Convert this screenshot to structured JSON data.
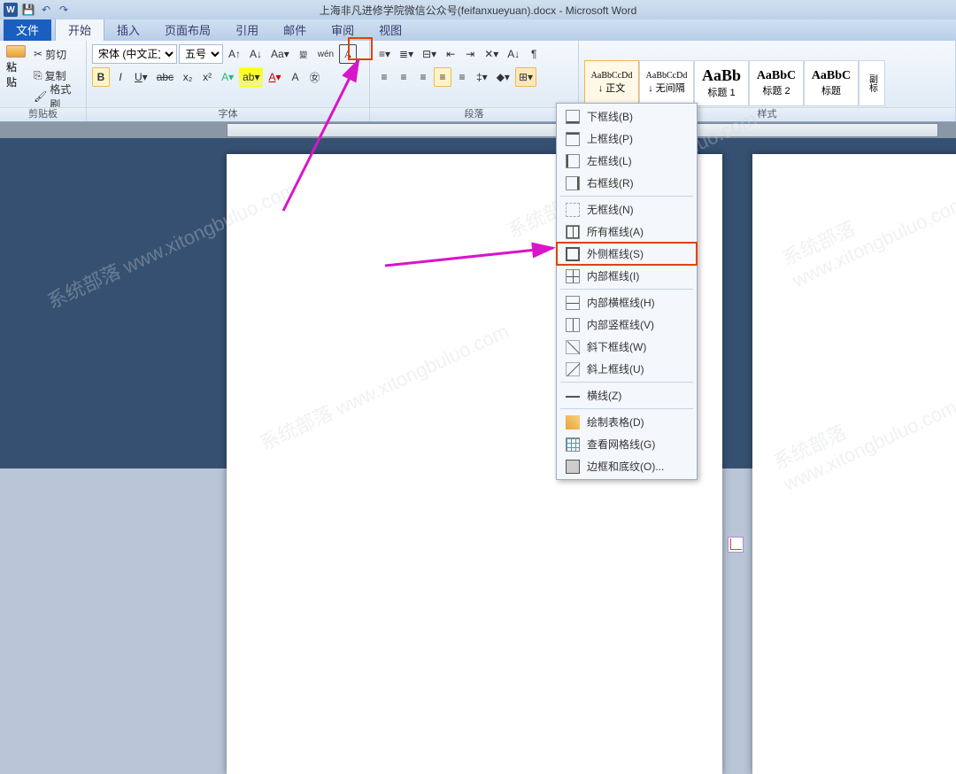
{
  "title": "上海非凡进修学院微信公众号(feifanxueyuan).docx - Microsoft Word",
  "qat": {
    "app": "W"
  },
  "tabs": {
    "file": "文件",
    "items": [
      "开始",
      "插入",
      "页面布局",
      "引用",
      "邮件",
      "审阅",
      "视图"
    ]
  },
  "groups": {
    "clipboard": {
      "label": "剪贴板",
      "paste": "粘贴",
      "cut": "剪切",
      "copy": "复制",
      "fmt": "格式刷"
    },
    "font": {
      "label": "字体",
      "fontname": "宋体 (中文正文)",
      "fontsize": "五号"
    },
    "paragraph": {
      "label": "段落"
    },
    "styles": {
      "label": "样式",
      "items": [
        {
          "sample": "AaBbCcDd",
          "name": "↓ 正文"
        },
        {
          "sample": "AaBbCcDd",
          "name": "↓ 无间隔"
        },
        {
          "sample": "AaBb",
          "name": "标题 1"
        },
        {
          "sample": "AaBbC",
          "name": "标题 2"
        },
        {
          "sample": "AaBbC",
          "name": "标题"
        },
        {
          "sample": "",
          "name": "副标"
        }
      ]
    }
  },
  "border_menu": [
    {
      "icon": "bottom",
      "label": "下框线(B)"
    },
    {
      "icon": "top",
      "label": "上框线(P)"
    },
    {
      "icon": "left",
      "label": "左框线(L)"
    },
    {
      "icon": "right",
      "label": "右框线(R)"
    },
    {
      "sep": true
    },
    {
      "icon": "none",
      "label": "无框线(N)"
    },
    {
      "icon": "all",
      "label": "所有框线(A)"
    },
    {
      "icon": "outer",
      "label": "外侧框线(S)",
      "highlight": true
    },
    {
      "icon": "inner",
      "label": "内部框线(I)"
    },
    {
      "sep": true
    },
    {
      "icon": "innerh",
      "label": "内部横框线(H)"
    },
    {
      "icon": "innerv",
      "label": "内部竖框线(V)"
    },
    {
      "icon": "diagd",
      "label": "斜下框线(W)"
    },
    {
      "icon": "diagu",
      "label": "斜上框线(U)"
    },
    {
      "sep": true
    },
    {
      "icon": "hr",
      "label": "横线(Z)"
    },
    {
      "sep": true
    },
    {
      "icon": "draw",
      "label": "绘制表格(D)"
    },
    {
      "icon": "grid",
      "label": "查看网格线(G)"
    },
    {
      "icon": "shade",
      "label": "边框和底纹(O)..."
    }
  ],
  "watermark": "系统部落 www.xitongbuluo.com"
}
